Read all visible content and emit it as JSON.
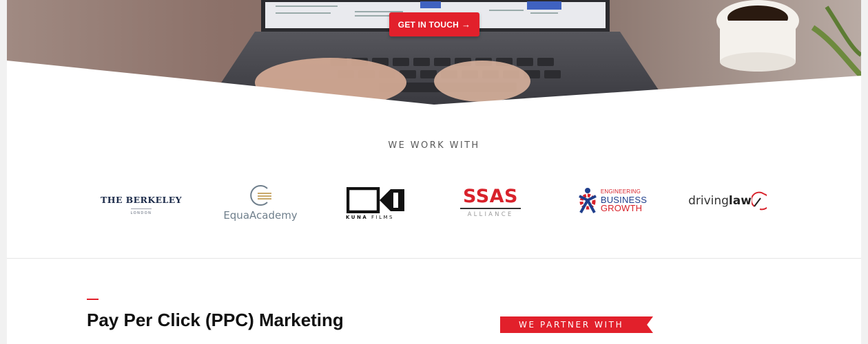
{
  "hero": {
    "cta_label": "GET IN TOUCH",
    "cta_arrow": "→",
    "accent_color": "#e2202b"
  },
  "clients": {
    "title": "WE WORK WITH",
    "logos": [
      {
        "name": "THE BERKELEY",
        "sub": "LONDON"
      },
      {
        "name": "EquaAcademy"
      },
      {
        "name_bold": "KUNA",
        "name_light": "FILMS"
      },
      {
        "name": "SSAS",
        "sub": "ALLIANCE"
      },
      {
        "line1": "ENGINEERING",
        "line2": "BUSINESS",
        "line3": "GROWTH"
      },
      {
        "part1": "driving",
        "part2": "law"
      }
    ]
  },
  "section": {
    "title": "Pay Per Click (PPC) Marketing",
    "partner_label": "WE PARTNER WITH"
  }
}
